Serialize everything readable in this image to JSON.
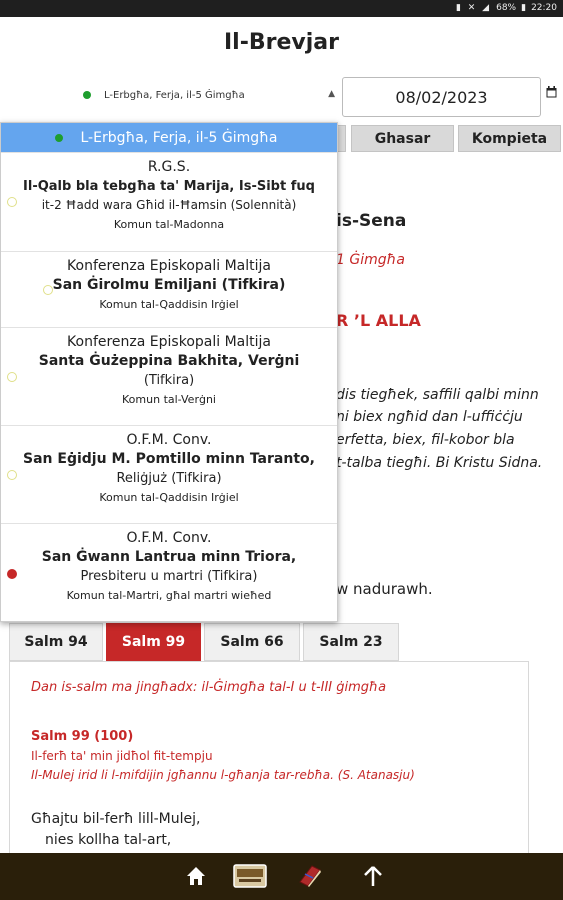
{
  "status": {
    "battery": "68%",
    "time": "22:20"
  },
  "app": {
    "title": "Il-Brevjar"
  },
  "day_selector": {
    "value": "L-Erbgħa, Ferja, il-5 Ġimgħa"
  },
  "date": {
    "value": "08/02/2023"
  },
  "hour_tabs": [
    "Ghasar",
    "Kompieta"
  ],
  "background_text": {
    "heading_fragment": "is-Sena",
    "week_fragment": "1 Ġimgħa",
    "section_fragment": "R ’L ALLA",
    "prayer_lines": [
      "dis tiegħek, saffili qalbi minn",
      "ni biex ngħid dan l-uffiċċju",
      "erfetta, biex, fil-kobor bla",
      "t-talba tiegħi. Bi Kristu Sidna."
    ],
    "invite_fragment": "w nadurawh."
  },
  "dropdown": {
    "items": [
      {
        "lines": [
          "L-Erbgħa, Ferja, il-5 Ġimgħa"
        ],
        "radio": "green"
      },
      {
        "lines": [
          "R.G.S.",
          "Il-Qalb bla tebgħa ta' Marija, Is-Sibt fuq",
          "it-2 Ħadd wara Għid il-Ħamsin (Solennità)"
        ],
        "common": "Komun tal-Madonna",
        "radio": "empty"
      },
      {
        "lines": [
          "Konferenza Episkopali Maltija",
          "San Ġirolmu Emiljani (Tifkira)"
        ],
        "common": "Komun tal-Qaddisin Irġiel",
        "radio": "empty"
      },
      {
        "lines": [
          "Konferenza Episkopali Maltija",
          "Santa Ġużeppina Bakhita, Verġni",
          "(Tifkira)"
        ],
        "common": "Komun tal-Verġni",
        "radio": "empty"
      },
      {
        "lines": [
          "O.F.M. Conv.",
          "San Eġidju M. Pomtillo minn Taranto,",
          "Reliġjuż (Tifkira)"
        ],
        "common": "Komun tal-Qaddisin Irġiel",
        "radio": "empty"
      },
      {
        "lines": [
          "O.F.M. Conv.",
          "San Ġwann Lantrua minn Triora,",
          "Presbiteru u martri (Tifkira)"
        ],
        "common": "Komun tal-Martri, għal martri wieħed",
        "radio": "red"
      }
    ]
  },
  "psalm_tabs": [
    "Salm 94",
    "Salm 99",
    "Salm 66",
    "Salm 23"
  ],
  "psalm": {
    "antiphon": "Dan is-salm ma jingħadx: il-Ġimgħa tal-I u t-III ġimgħa",
    "heading": "Salm 99 (100)",
    "subtitle": "Il-ferħ ta' min jidħol fit-tempju",
    "quote": "Il-Mulej irid li l-mifdijin jgħannu l-għanja tar-rebħa. (S. Atanasju)",
    "verses": [
      "Għajtu bil-ferħ lill-Mulej,",
      "nies kollha tal-art,"
    ]
  },
  "colors": {
    "accent_red": "#c62828",
    "selection_blue": "#64a5ee",
    "bottom_bar": "#2a1f0a"
  },
  "icons": [
    "home-icon",
    "breviary-icon",
    "book-icon",
    "arrow-up-icon"
  ]
}
